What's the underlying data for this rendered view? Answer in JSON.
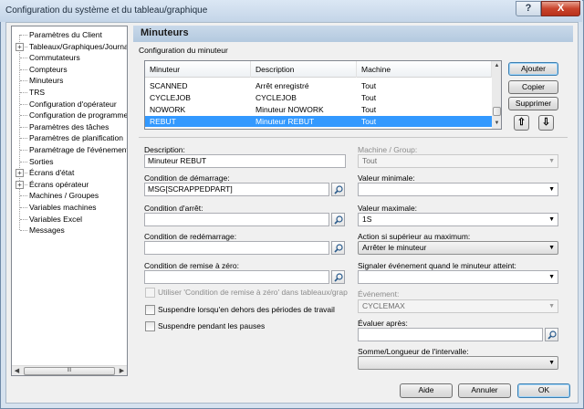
{
  "window": {
    "title": "Configuration du système et du tableau/graphique",
    "help_glyph": "?",
    "close_glyph": "X"
  },
  "tree": {
    "items": [
      {
        "label": "Paramètres du Client",
        "expandable": false
      },
      {
        "label": "Tableaux/Graphiques/Journal",
        "expandable": true
      },
      {
        "label": "Commutateurs",
        "expandable": false
      },
      {
        "label": "Compteurs",
        "expandable": false
      },
      {
        "label": "Minuteurs",
        "expandable": false
      },
      {
        "label": "TRS",
        "expandable": false
      },
      {
        "label": "Configuration d'opérateur",
        "expandable": false
      },
      {
        "label": "Configuration de programme",
        "expandable": false
      },
      {
        "label": "Paramètres des tâches",
        "expandable": false
      },
      {
        "label": "Paramètres de planification",
        "expandable": false
      },
      {
        "label": "Paramétrage de l'événement",
        "expandable": false
      },
      {
        "label": "Sorties",
        "expandable": false
      },
      {
        "label": "Écrans d'état",
        "expandable": true
      },
      {
        "label": "Écrans opérateur",
        "expandable": true
      },
      {
        "label": "Machines / Groupes",
        "expandable": false
      },
      {
        "label": "Variables machines",
        "expandable": false
      },
      {
        "label": "Variables Excel",
        "expandable": false
      },
      {
        "label": "Messages",
        "expandable": false
      }
    ],
    "scroll_thumb_grip": "III"
  },
  "panel": {
    "title": "Minuteurs",
    "subtitle": "Configuration du minuteur"
  },
  "grid": {
    "columns": [
      "Minuteur",
      "Description",
      "Machine"
    ],
    "rows": [
      [
        "SCANNED",
        "Arrêt enregistré",
        "Tout"
      ],
      [
        "CYCLEJOB",
        "CYCLEJOB",
        "Tout"
      ],
      [
        "NOWORK",
        "Minuteur NOWORK",
        "Tout"
      ],
      [
        "REBUT",
        "Minuteur REBUT",
        "Tout"
      ]
    ],
    "selected_row": 3
  },
  "buttons": {
    "add": "Ajouter",
    "copy": "Copier",
    "delete": "Supprimer",
    "up_glyph": "⇧",
    "down_glyph": "⇩",
    "help": "Aide",
    "cancel": "Annuler",
    "ok": "OK"
  },
  "form": {
    "description_label": "Description:",
    "description_value": "Minuteur REBUT",
    "start_label": "Condition de démarrage:",
    "start_value": "MSG[SCRAPPEDPART]",
    "stop_label": "Condition d'arrêt:",
    "stop_value": "",
    "restart_label": "Condition de redémarrage:",
    "restart_value": "",
    "reset_label": "Condition de remise à zéro:",
    "reset_value": "",
    "use_reset_label": "Utiliser 'Condition de remise à zéro' dans tableaux/graphiques",
    "suspend_outside_label": "Suspendre lorsqu'en dehors des périodes de travail",
    "suspend_breaks_label": "Suspendre pendant les pauses",
    "machine_group_label": "Machine / Group:",
    "machine_group_value": "Tout",
    "min_label": "Valeur minimale:",
    "min_value": "",
    "max_label": "Valeur maximale:",
    "max_value": "1S",
    "action_label": "Action si supérieur au maximum:",
    "action_value": "Arrêter le minuteur",
    "signal_label": "Signaler événement quand le minuteur atteint:",
    "signal_value": "",
    "event_label": "Événement:",
    "event_value": "CYCLEMAX",
    "evaluate_label": "Évaluer après:",
    "evaluate_value": "",
    "sum_label": "Somme/Longueur de l'intervalle:",
    "sum_value": ""
  }
}
